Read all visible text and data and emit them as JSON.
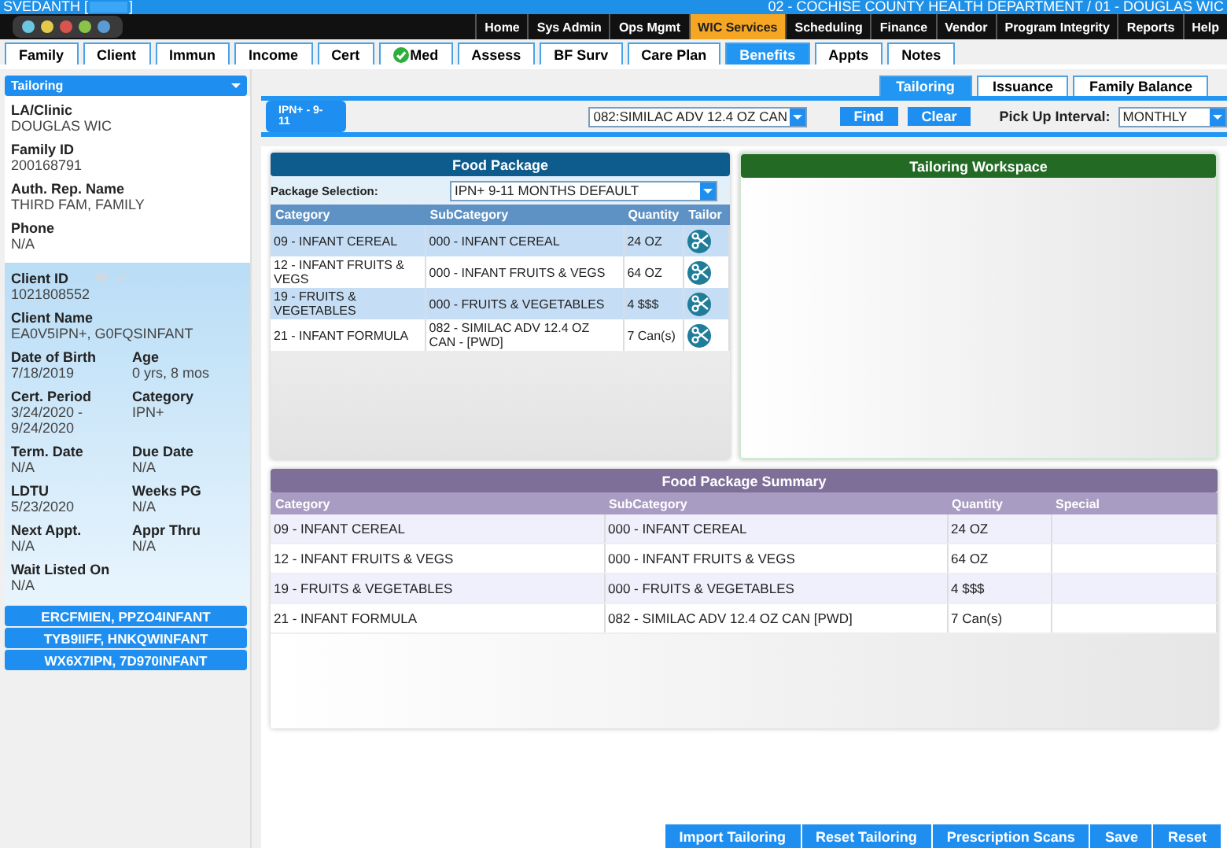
{
  "header": {
    "user": "SVEDANTH [",
    "user_end": "]",
    "agency": "02 - COCHISE COUNTY HEALTH DEPARTMENT / 01 - DOUGLAS WIC"
  },
  "menu": [
    {
      "label": "Home",
      "selected": false
    },
    {
      "label": "Sys Admin",
      "selected": false
    },
    {
      "label": "Ops Mgmt",
      "selected": false
    },
    {
      "label": "WIC Services",
      "selected": true
    },
    {
      "label": "Scheduling",
      "selected": false
    },
    {
      "label": "Finance",
      "selected": false
    },
    {
      "label": "Vendor",
      "selected": false
    },
    {
      "label": "Program Integrity",
      "selected": false
    },
    {
      "label": "Reports",
      "selected": false
    },
    {
      "label": "Help",
      "selected": false
    }
  ],
  "tabs": [
    {
      "label": "Family",
      "selected": false,
      "complete": false
    },
    {
      "label": "Client",
      "selected": false,
      "complete": false
    },
    {
      "label": "Immun",
      "selected": false,
      "complete": false
    },
    {
      "label": "Income",
      "selected": false,
      "complete": false
    },
    {
      "label": "Cert",
      "selected": false,
      "complete": false
    },
    {
      "label": "Med",
      "selected": false,
      "complete": true
    },
    {
      "label": "Assess",
      "selected": false,
      "complete": false
    },
    {
      "label": "BF Surv",
      "selected": false,
      "complete": false
    },
    {
      "label": "Care Plan",
      "selected": false,
      "complete": false
    },
    {
      "label": "Benefits",
      "selected": true,
      "complete": false
    },
    {
      "label": "Appts",
      "selected": false,
      "complete": false
    },
    {
      "label": "Notes",
      "selected": false,
      "complete": false
    }
  ],
  "sidebar": {
    "dropdown": "Tailoring",
    "family_fields": [
      {
        "label": "LA/Clinic",
        "value": "DOUGLAS WIC"
      },
      {
        "label": "Family ID",
        "value": "200168791"
      },
      {
        "label": "Auth. Rep. Name",
        "value": "THIRD FAM, FAMILY"
      },
      {
        "label": "Phone",
        "value": "N/A"
      }
    ],
    "client_id": {
      "label": "Client ID",
      "value": "1021808552"
    },
    "client_name": {
      "label": "Client Name",
      "value": "EA0V5IPN+, G0FQSINFANT"
    },
    "client_pairs": [
      [
        {
          "label": "Date of Birth",
          "value": "7/18/2019"
        },
        {
          "label": "Age",
          "value": "0 yrs, 8 mos"
        }
      ],
      [
        {
          "label": "Cert. Period",
          "value": "3/24/2020 - 9/24/2020"
        },
        {
          "label": "Category",
          "value": "IPN+"
        }
      ],
      [
        {
          "label": "Term. Date",
          "value": "N/A"
        },
        {
          "label": "Due Date",
          "value": "N/A"
        }
      ],
      [
        {
          "label": "LDTU",
          "value": "5/23/2020"
        },
        {
          "label": "Weeks PG",
          "value": "N/A"
        }
      ],
      [
        {
          "label": "Next Appt.",
          "value": "N/A"
        },
        {
          "label": "Appr Thru",
          "value": "N/A"
        }
      ]
    ],
    "wait_listed": {
      "label": "Wait Listed On",
      "value": "N/A"
    },
    "members": [
      "ERCFMIEN, PPZO4INFANT",
      "TYB9IIFF, HNKQWINFANT",
      "WX6X7IPN, 7D970INFANT"
    ]
  },
  "subtabs": [
    {
      "label": "Tailoring",
      "selected": true
    },
    {
      "label": "Issuance",
      "selected": false
    },
    {
      "label": "Family Balance",
      "selected": false
    }
  ],
  "toolbar": {
    "category": "IPN+ - 9-11",
    "product": "082:SIMILAC ADV 12.4 OZ CAN",
    "find": "Find",
    "clear": "Clear",
    "interval_label": "Pick Up Interval:",
    "interval": "MONTHLY"
  },
  "food_package": {
    "title": "Food Package",
    "selection_label": "Package Selection:",
    "selection": "IPN+ 9-11 MONTHS DEFAULT",
    "columns": [
      "Category",
      "SubCategory",
      "Quantity",
      "Tailor"
    ],
    "rows": [
      [
        "09 - INFANT CEREAL",
        "000 - INFANT CEREAL",
        "24 OZ"
      ],
      [
        "12 - INFANT FRUITS & VEGS",
        "000 - INFANT FRUITS & VEGS",
        "64 OZ"
      ],
      [
        "19 - FRUITS & VEGETABLES",
        "000 - FRUITS & VEGETABLES",
        "4 $$$"
      ],
      [
        "21 - INFANT FORMULA",
        "082 - SIMILAC ADV 12.4 OZ CAN - [PWD]",
        "7 Can(s)"
      ]
    ]
  },
  "workspace": {
    "title": "Tailoring Workspace"
  },
  "summary": {
    "title": "Food Package Summary",
    "columns": [
      "Category",
      "SubCategory",
      "Quantity",
      "Special"
    ],
    "rows": [
      [
        "09 - INFANT CEREAL",
        "000 - INFANT CEREAL",
        "24 OZ"
      ],
      [
        "12 - INFANT FRUITS & VEGS",
        "000 - INFANT FRUITS & VEGS",
        "64 OZ"
      ],
      [
        "19 - FRUITS & VEGETABLES",
        "000 - FRUITS & VEGETABLES",
        "4 $$$"
      ],
      [
        "21 - INFANT FORMULA",
        "082 - SIMILAC ADV 12.4 OZ CAN [PWD]",
        "7 Can(s)"
      ]
    ]
  },
  "footer_buttons": [
    "Import Tailoring",
    "Reset Tailoring",
    "Prescription Scans",
    "Save",
    "Reset"
  ]
}
